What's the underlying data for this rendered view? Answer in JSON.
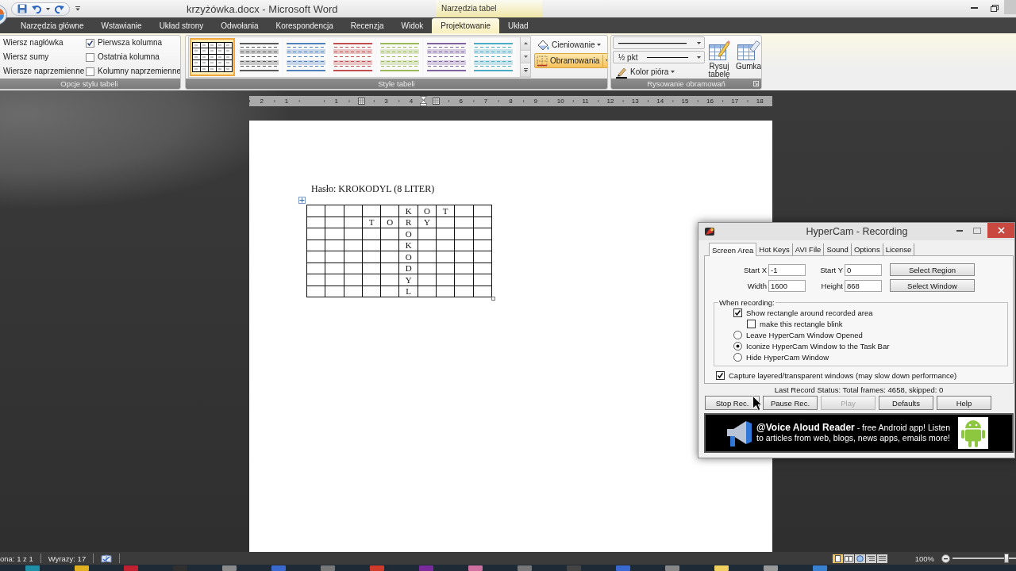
{
  "word_window": {
    "title": "krzyżówka.docx - Microsoft Word",
    "contextual_tab_group": "Narzędzia tabel",
    "tabs": [
      {
        "label": "Narzędzia główne",
        "selected": false
      },
      {
        "label": "Wstawianie",
        "selected": false
      },
      {
        "label": "Układ strony",
        "selected": false
      },
      {
        "label": "Odwołania",
        "selected": false
      },
      {
        "label": "Korespondencja",
        "selected": false
      },
      {
        "label": "Recenzja",
        "selected": false
      },
      {
        "label": "Widok",
        "selected": false
      },
      {
        "label": "Projektowanie",
        "selected": true
      },
      {
        "label": "Układ",
        "selected": false
      }
    ],
    "ribbon": {
      "style_options": {
        "left_options": [
          "Wiersz nagłówka",
          "Wiersz sumy",
          "Wiersze naprzemienne"
        ],
        "right_options": [
          {
            "label": "Pierwsza kolumna",
            "checked": true
          },
          {
            "label": "Ostatnia kolumna",
            "checked": false
          },
          {
            "label": "Kolumny naprzemienne",
            "checked": false
          }
        ],
        "label": "Opcje stylu tabeli"
      },
      "table_styles": {
        "gallery": [
          {
            "kind": "grid",
            "color": "#000000",
            "selected": true
          },
          {
            "kind": "banded",
            "color": "#595959",
            "selected": false
          },
          {
            "kind": "banded",
            "color": "#4f81bd",
            "selected": false
          },
          {
            "kind": "banded",
            "color": "#c0504d",
            "selected": false
          },
          {
            "kind": "banded",
            "color": "#9bbb59",
            "selected": false
          },
          {
            "kind": "banded",
            "color": "#8064a2",
            "selected": false
          },
          {
            "kind": "banded",
            "color": "#4bacc6",
            "selected": false
          }
        ],
        "shading_button": "Cieniowanie",
        "borders_button": {
          "label": "Obramowania",
          "highlighted": true
        },
        "label": "Style tabeli"
      },
      "draw_borders": {
        "line_weight": "½ pkt",
        "pen_color_button": "Kolor pióra",
        "draw_table_button": "Rysuj tabelę",
        "eraser_button": "Gumka",
        "label": "Rysowanie obramowań"
      }
    },
    "ruler": {
      "left_margin_numbers": [
        "2",
        "1"
      ],
      "marks": [
        {
          "kind": "number",
          "text": "1"
        },
        {
          "kind": "column"
        },
        {
          "kind": "number",
          "text": "3"
        },
        {
          "kind": "number",
          "text": "4"
        },
        {
          "kind": "column"
        },
        {
          "kind": "number",
          "text": "6"
        },
        {
          "kind": "number",
          "text": "7"
        },
        {
          "kind": "number",
          "text": "8"
        },
        {
          "kind": "number",
          "text": "9"
        },
        {
          "kind": "number",
          "text": "10"
        },
        {
          "kind": "number",
          "text": "11"
        },
        {
          "kind": "number",
          "text": "12"
        },
        {
          "kind": "number",
          "text": "13"
        },
        {
          "kind": "number",
          "text": "14"
        },
        {
          "kind": "number",
          "text": "15"
        },
        {
          "kind": "number",
          "text": "16"
        },
        {
          "kind": "number",
          "text": "17"
        },
        {
          "kind": "number",
          "text": "18"
        }
      ]
    },
    "document": {
      "heading": "Hasło: KROKODYL (8 LITER)",
      "crossword": [
        [
          {
            "kind": "empty"
          },
          {
            "kind": "empty"
          },
          {
            "kind": "empty"
          },
          {
            "kind": "empty"
          },
          {
            "kind": "empty"
          },
          {
            "kind": "letter",
            "text": "K"
          },
          {
            "kind": "letter",
            "text": "O"
          },
          {
            "kind": "letter",
            "text": "T"
          },
          {
            "kind": "empty"
          },
          {
            "kind": "empty"
          }
        ],
        [
          {
            "kind": "empty"
          },
          {
            "kind": "empty"
          },
          {
            "kind": "empty"
          },
          {
            "kind": "letter",
            "text": "T"
          },
          {
            "kind": "letter",
            "text": "O"
          },
          {
            "kind": "letter",
            "text": "R"
          },
          {
            "kind": "letter",
            "text": "Y"
          },
          {
            "kind": "empty"
          },
          {
            "kind": "empty"
          },
          {
            "kind": "empty"
          }
        ],
        [
          {
            "kind": "empty"
          },
          {
            "kind": "empty"
          },
          {
            "kind": "empty"
          },
          {
            "kind": "empty"
          },
          {
            "kind": "empty"
          },
          {
            "kind": "letter",
            "text": "O"
          },
          {
            "kind": "empty"
          },
          {
            "kind": "empty"
          },
          {
            "kind": "empty"
          },
          {
            "kind": "empty"
          }
        ],
        [
          {
            "kind": "empty"
          },
          {
            "kind": "empty"
          },
          {
            "kind": "empty"
          },
          {
            "kind": "empty"
          },
          {
            "kind": "empty"
          },
          {
            "kind": "letter",
            "text": "K"
          },
          {
            "kind": "empty"
          },
          {
            "kind": "empty"
          },
          {
            "kind": "empty"
          },
          {
            "kind": "empty"
          }
        ],
        [
          {
            "kind": "empty"
          },
          {
            "kind": "empty"
          },
          {
            "kind": "empty"
          },
          {
            "kind": "empty"
          },
          {
            "kind": "empty"
          },
          {
            "kind": "letter",
            "text": "O"
          },
          {
            "kind": "empty"
          },
          {
            "kind": "empty"
          },
          {
            "kind": "empty"
          },
          {
            "kind": "empty"
          }
        ],
        [
          {
            "kind": "empty"
          },
          {
            "kind": "empty"
          },
          {
            "kind": "empty"
          },
          {
            "kind": "empty"
          },
          {
            "kind": "empty"
          },
          {
            "kind": "letter",
            "text": "D"
          },
          {
            "kind": "empty"
          },
          {
            "kind": "empty"
          },
          {
            "kind": "empty"
          },
          {
            "kind": "empty"
          }
        ],
        [
          {
            "kind": "empty"
          },
          {
            "kind": "empty"
          },
          {
            "kind": "empty"
          },
          {
            "kind": "empty"
          },
          {
            "kind": "empty"
          },
          {
            "kind": "letter",
            "text": "Y"
          },
          {
            "kind": "empty"
          },
          {
            "kind": "empty"
          },
          {
            "kind": "empty"
          },
          {
            "kind": "empty"
          }
        ],
        [
          {
            "kind": "empty"
          },
          {
            "kind": "empty"
          },
          {
            "kind": "empty"
          },
          {
            "kind": "empty"
          },
          {
            "kind": "empty"
          },
          {
            "kind": "letter",
            "text": "L"
          },
          {
            "kind": "empty"
          },
          {
            "kind": "empty"
          },
          {
            "kind": "empty"
          },
          {
            "kind": "empty"
          }
        ]
      ]
    },
    "status_bar": {
      "page": "ona: 1 z 1",
      "words": "Wyrazy: 17",
      "views": [
        {
          "selected": true
        },
        {
          "selected": false
        },
        {
          "selected": false
        },
        {
          "selected": false
        },
        {
          "selected": false
        }
      ],
      "zoom": "100%",
      "zoom_slider": {
        "level": 0.85
      }
    }
  },
  "hypercam_window": {
    "title": "HyperCam - Recording",
    "tabs": [
      {
        "label": "Screen Area",
        "selected": true
      },
      {
        "label": "Hot Keys",
        "selected": false
      },
      {
        "label": "AVI File",
        "selected": false
      },
      {
        "label": "Sound",
        "selected": false
      },
      {
        "label": "Options",
        "selected": false
      },
      {
        "label": "License",
        "selected": false
      }
    ],
    "fields": [
      {
        "label": "Start X",
        "value": "-1"
      },
      {
        "label": "Start Y",
        "value": "0"
      },
      {
        "label": "Width",
        "value": "1600"
      },
      {
        "label": "Height",
        "value": "868"
      }
    ],
    "region_buttons": [
      "Select Region",
      "Select Window"
    ],
    "when_recording": {
      "label": "When recording:",
      "items": [
        {
          "kind": "checkbox",
          "label": "Show rectangle around recorded area",
          "checked": true,
          "children": [
            {
              "kind": "checkbox",
              "label": "make this rectangle blink",
              "checked": false
            }
          ]
        },
        {
          "kind": "radio",
          "label": "Leave HyperCam Window Opened",
          "selected": false
        },
        {
          "kind": "radio",
          "label": "Iconize HyperCam Window to the Task Bar",
          "selected": true
        },
        {
          "kind": "radio",
          "label": "Hide HyperCam Window",
          "selected": false
        }
      ]
    },
    "capture_option": {
      "label": "Capture layered/transparent windows (may slow down performance)",
      "checked": true
    },
    "status": "Last Record Status: Total frames: 4658, skipped: 0",
    "buttons": [
      {
        "label": "Stop Rec.",
        "disabled": false
      },
      {
        "label": "Pause Rec.",
        "disabled": false
      },
      {
        "label": "Play",
        "disabled": true
      },
      {
        "label": "Defaults",
        "disabled": false
      },
      {
        "label": "Help",
        "disabled": false
      }
    ],
    "ad": "**@Voice Aloud Reader** - free Android app! Listen to articles from web, blogs, news apps, emails more!"
  }
}
